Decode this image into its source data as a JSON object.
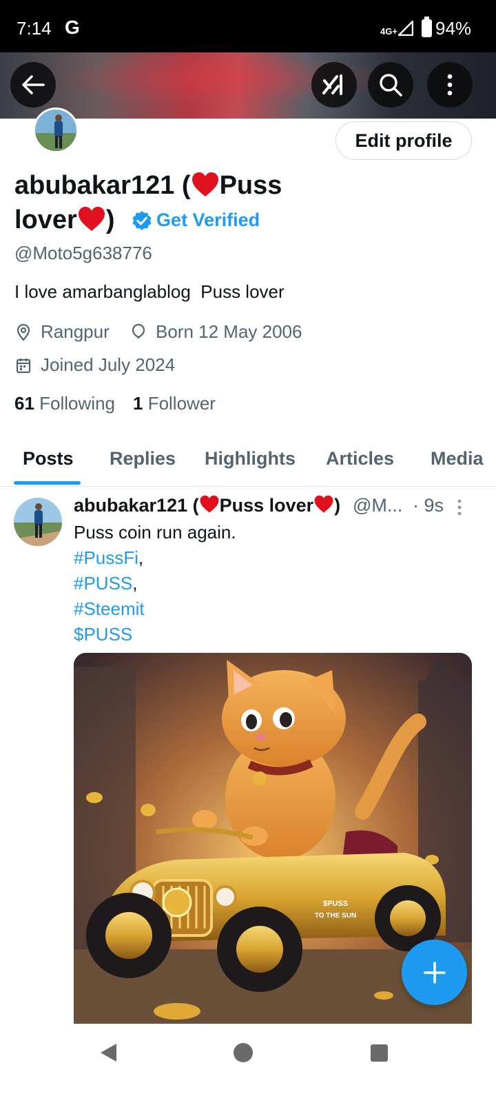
{
  "status_bar": {
    "time": "7:14",
    "app_icon": "G",
    "network": "4G+",
    "battery": "94%"
  },
  "header": {
    "back_icon": "arrow-left-icon",
    "grok_icon": "grok-icon",
    "search_icon": "search-icon",
    "more_icon": "more-vertical-icon"
  },
  "profile": {
    "edit_label": "Edit profile",
    "name_part1": "abubakar121 (",
    "name_part2": "Puss",
    "name_part3": "lover",
    "name_part4": ")",
    "get_verified": "Get Verified",
    "handle": "@Moto5g638776",
    "bio": "I love amarbanglablog  Puss lover",
    "location": "Rangpur",
    "birth": "Born 12 May 2006",
    "joined": "Joined July 2024",
    "following_count": "61",
    "following_label": "Following",
    "followers_count": "1",
    "followers_label": "Follower"
  },
  "tabs": [
    "Posts",
    "Replies",
    "Highlights",
    "Articles",
    "Media"
  ],
  "post": {
    "author_part1": "abubakar121 (",
    "author_part2": "Puss lover",
    "author_part3": ")",
    "handle": "@M...",
    "time": "· 9s",
    "line1": "Puss coin run again.",
    "tag1": "#PussFi",
    "tag2": "#PUSS",
    "tag3": "#Steemit",
    "tag4": "$PUSS",
    "car_text1": "$PUSS",
    "car_text2": "TO THE SUN"
  },
  "colors": {
    "accent": "#1d9bf0",
    "heart": "#e0101e",
    "text_secondary": "#536471"
  }
}
